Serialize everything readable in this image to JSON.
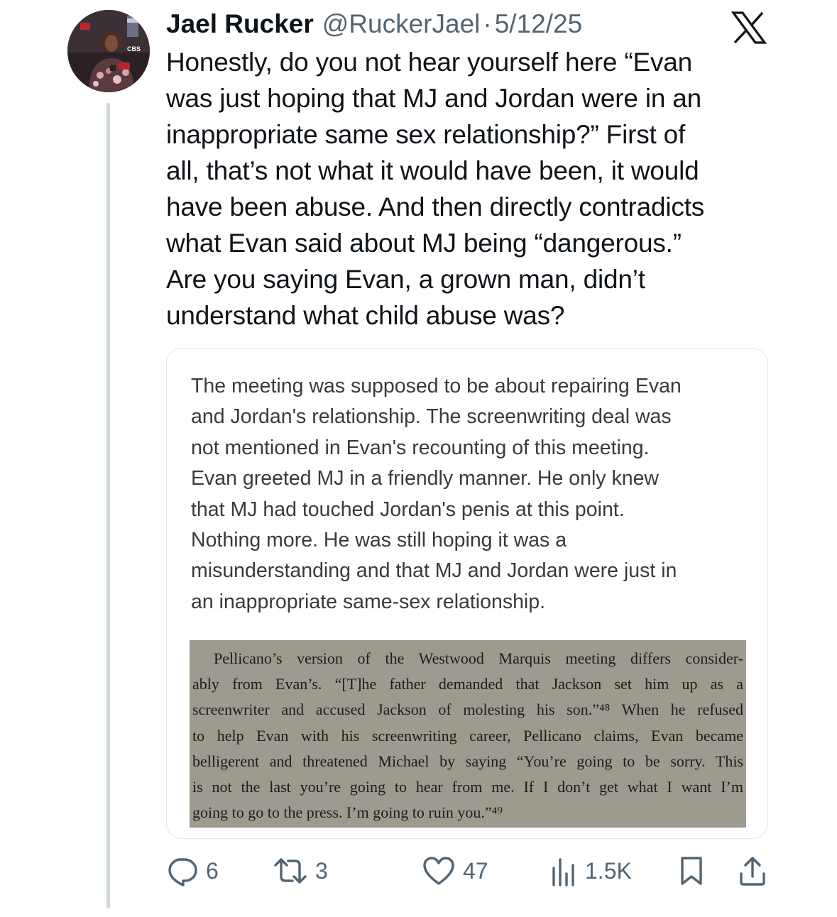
{
  "tweet": {
    "author_name": "Jael Rucker",
    "handle": "@RuckerJael",
    "separator": "·",
    "date": "5/12/25",
    "text_lines": [
      "Honestly, do you not hear yourself here “Evan",
      "was just hoping that MJ and Jordan were in an",
      "inappropriate same sex relationship?” First of",
      "all, that’s not what it would have been, it would",
      "have been abuse. And then directly contradicts",
      "what Evan said about MJ being “dangerous.”",
      "Are you saying Evan, a grown man, didn’t",
      "understand what child abuse was?"
    ]
  },
  "avatar": {
    "badge_text": "CBS"
  },
  "quote": {
    "text_lines": [
      "The meeting was supposed to be about repairing Evan",
      "and Jordan's relationship. The screenwriting deal was",
      "not mentioned in Evan's recounting of this meeting.",
      "Evan greeted MJ in a friendly manner. He only knew",
      "that MJ had touched Jordan's penis at this point.",
      "Nothing more. He was still hoping it was a",
      "misunderstanding and that MJ and Jordan were just in",
      "an inappropriate same-sex relationship."
    ],
    "book_lines": [
      "Pellicano’s version of the Westwood Marquis meeting differs consider-",
      "ably from Evan’s. “[T]he father demanded that Jackson set him up as a",
      "screenwriter and accused Jackson of molesting his son.”⁴⁸ When he refused",
      "to help Evan with his screenwriting career, Pellicano claims, Evan became",
      "belligerent and threatened Michael by saying “You’re going to be sorry. This",
      "is not the last you’re going to hear from me. If I don’t get what I want I’m",
      "going to go to the press. I’m going to ruin you.”⁴⁹"
    ]
  },
  "actions": {
    "replies": "6",
    "reposts": "3",
    "likes": "47",
    "views": "1.5K"
  },
  "colors": {
    "text": "#0f1419",
    "muted": "#536471",
    "thread_line": "#cfd9de",
    "card_border": "#e4e8eb",
    "scan_background": "#9d9a90"
  }
}
